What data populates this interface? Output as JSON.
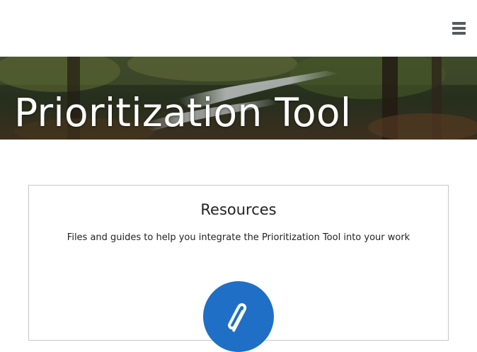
{
  "header": {
    "menu_icon": "hamburger-menu-icon"
  },
  "hero": {
    "title": "Prioritization Tool"
  },
  "resources": {
    "title": "Resources",
    "subtitle": "Files and guides to help you integrate the Prioritization Tool into your work",
    "icon": "paperclip-icon",
    "accent": "#1f6fc6"
  }
}
